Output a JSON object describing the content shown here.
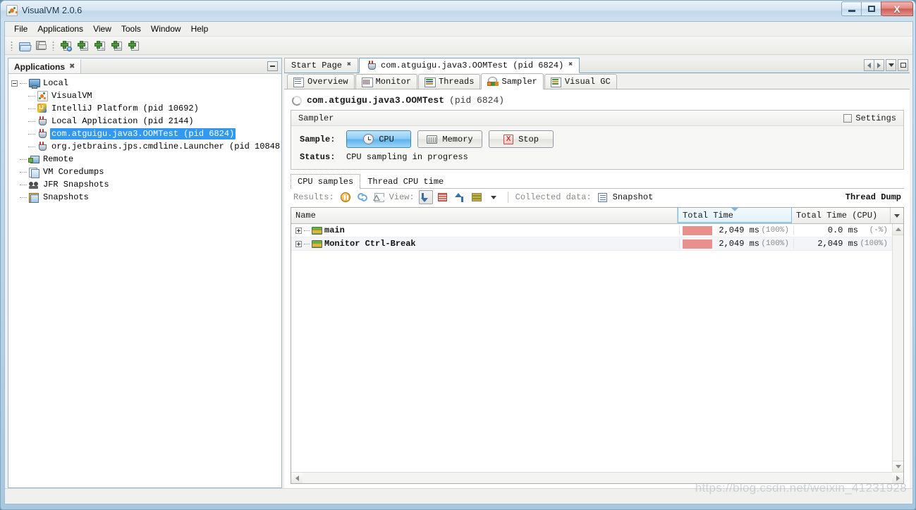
{
  "window": {
    "title": "VisualVM 2.0.6",
    "app_icon": "visualvm-icon",
    "minimize_label": "Minimize",
    "maximize_label": "Maximize",
    "close_label": "X"
  },
  "menubar": {
    "items": [
      {
        "label": "File"
      },
      {
        "label": "Applications"
      },
      {
        "label": "View"
      },
      {
        "label": "Tools"
      },
      {
        "label": "Window"
      },
      {
        "label": "Help"
      }
    ]
  },
  "toolbar": {
    "buttons": [
      {
        "name": "open-file-button",
        "icon": "folder-open-icon"
      },
      {
        "name": "save-button",
        "icon": "save-disk-icon"
      },
      {
        "name": "add-remote-host-button",
        "icon": "add-host-icon"
      },
      {
        "name": "add-jmx-connection-button",
        "icon": "add-jmx-icon",
        "badge": "JMX"
      },
      {
        "name": "add-vm-coredump-button",
        "icon": "add-coredump-icon",
        "badge": "01"
      },
      {
        "name": "add-jfr-snapshot-button",
        "icon": "add-jfr-icon",
        "badge": "JFR"
      },
      {
        "name": "add-snapshot-button",
        "icon": "add-snapshot-icon",
        "badge": ""
      }
    ]
  },
  "applications_panel": {
    "tab_label": "Applications",
    "close_glyph": "✖",
    "tree": [
      {
        "label": "Local",
        "icon": "local-monitor-icon",
        "depth": 0,
        "expanded": true,
        "selected": false
      },
      {
        "label": "VisualVM",
        "icon": "visualvm-icon",
        "depth": 1,
        "selected": false
      },
      {
        "label": "IntelliJ Platform  (pid 10692)",
        "icon": "intellij-icon",
        "depth": 1,
        "selected": false
      },
      {
        "label": "Local Application  (pid 2144)",
        "icon": "java-cup-icon",
        "depth": 1,
        "selected": false
      },
      {
        "label": "com.atguigu.java3.OOMTest  (pid 6824)",
        "icon": "java-cup-icon",
        "depth": 1,
        "selected": true
      },
      {
        "label": "org.jetbrains.jps.cmdline.Launcher  (pid 10848)",
        "icon": "java-cup-icon",
        "depth": 1,
        "selected": false
      },
      {
        "label": "Remote",
        "icon": "remote-host-icon",
        "depth": 0,
        "selected": false
      },
      {
        "label": "VM Coredumps",
        "icon": "coredump-icon",
        "depth": 0,
        "selected": false
      },
      {
        "label": "JFR Snapshots",
        "icon": "jfr-icon",
        "depth": 0,
        "selected": false
      },
      {
        "label": "Snapshots",
        "icon": "snapshots-icon",
        "depth": 0,
        "selected": false
      }
    ]
  },
  "document_tabs": {
    "tabs": [
      {
        "label": "Start Page",
        "icon": null,
        "active": false,
        "closable": true
      },
      {
        "label": "com.atguigu.java3.OOMTest  (pid 6824)",
        "icon": "java-cup-icon",
        "active": true,
        "closable": true
      }
    ],
    "close_glyph": "✖"
  },
  "sub_tabs": [
    {
      "label": "Overview",
      "icon": "overview-icon",
      "active": false
    },
    {
      "label": "Monitor",
      "icon": "monitor-icon",
      "active": false
    },
    {
      "label": "Threads",
      "icon": "threads-icon",
      "active": false
    },
    {
      "label": "Sampler",
      "icon": "sampler-icon",
      "active": true
    },
    {
      "label": "Visual GC",
      "icon": "visual-gc-icon",
      "active": false
    }
  ],
  "sampler": {
    "process_title": "com.atguigu.java3.OOMTest",
    "process_pid": "(pid 6824)",
    "section_title": "Sampler",
    "settings_label": "Settings",
    "settings_checked": false,
    "sample_label": "Sample:",
    "buttons": [
      {
        "label": "CPU",
        "icon": "cpu-clock-icon",
        "active": true
      },
      {
        "label": "Memory",
        "icon": "memory-chip-icon",
        "active": false
      },
      {
        "label": "Stop",
        "icon": "stop-x-icon",
        "active": false
      }
    ],
    "status_label": "Status:",
    "status_text": "CPU sampling in progress"
  },
  "results": {
    "tabs": [
      {
        "label": "CPU samples",
        "active": true
      },
      {
        "label": "Thread CPU time",
        "active": false
      }
    ],
    "results_label": "Results:",
    "results_buttons": [
      {
        "name": "pause-results-button",
        "icon": "pause-icon"
      },
      {
        "name": "refresh-results-button",
        "icon": "refresh-icon"
      },
      {
        "name": "delta-results-button",
        "icon": "delta-triangle-icon"
      }
    ],
    "view_label": "View:",
    "view_buttons": [
      {
        "name": "view-forward-calls-button",
        "icon": "forward-arrow-icon",
        "selected": true
      },
      {
        "name": "view-hot-spots-button",
        "icon": "grid-table-icon",
        "selected": false
      },
      {
        "name": "view-reverse-calls-button",
        "icon": "back-arrow-icon",
        "selected": false
      },
      {
        "name": "view-combined-button",
        "icon": "list-view-icon",
        "selected": false
      }
    ],
    "collected_data_label": "Collected data:",
    "snapshot_label": "Snapshot",
    "snapshot_icon": "snapshot-icon",
    "thread_dump_label": "Thread Dump",
    "columns": [
      {
        "key": "name",
        "label": "Name",
        "sorted": false
      },
      {
        "key": "total",
        "label": "Total Time",
        "sorted": true,
        "direction": "desc"
      },
      {
        "key": "cpu",
        "label": "Total Time (CPU)",
        "sorted": false
      }
    ],
    "rows": [
      {
        "name": "main",
        "icon": "thread-icon",
        "expandable": true,
        "total_time": "2,049 ms",
        "total_pct": "(100%)",
        "total_bar_pct": 100,
        "cpu_time": "0.0 ms",
        "cpu_pct": "(-%)"
      },
      {
        "name": "Monitor Ctrl-Break",
        "icon": "thread-icon",
        "expandable": true,
        "total_time": "2,049 ms",
        "total_pct": "(100%)",
        "total_bar_pct": 100,
        "cpu_time": "2,049 ms",
        "cpu_pct": "(100%)"
      }
    ]
  },
  "watermark": "https://blog.csdn.net/weixin_41231928",
  "colors": {
    "selection_blue": "#3399f0",
    "bar_red": "#e8918c",
    "active_button_blue": "#5cb4ee",
    "sorted_column": "#e2f1fb"
  }
}
